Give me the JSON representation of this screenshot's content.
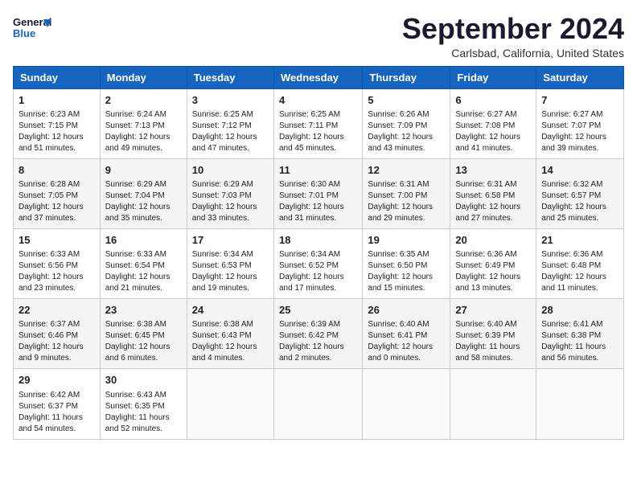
{
  "header": {
    "logo_line1": "General",
    "logo_line2": "Blue",
    "month_title": "September 2024",
    "location": "Carlsbad, California, United States"
  },
  "days_of_week": [
    "Sunday",
    "Monday",
    "Tuesday",
    "Wednesday",
    "Thursday",
    "Friday",
    "Saturday"
  ],
  "weeks": [
    [
      {
        "day": 1,
        "lines": [
          "Sunrise: 6:23 AM",
          "Sunset: 7:15 PM",
          "Daylight: 12 hours",
          "and 51 minutes."
        ]
      },
      {
        "day": 2,
        "lines": [
          "Sunrise: 6:24 AM",
          "Sunset: 7:13 PM",
          "Daylight: 12 hours",
          "and 49 minutes."
        ]
      },
      {
        "day": 3,
        "lines": [
          "Sunrise: 6:25 AM",
          "Sunset: 7:12 PM",
          "Daylight: 12 hours",
          "and 47 minutes."
        ]
      },
      {
        "day": 4,
        "lines": [
          "Sunrise: 6:25 AM",
          "Sunset: 7:11 PM",
          "Daylight: 12 hours",
          "and 45 minutes."
        ]
      },
      {
        "day": 5,
        "lines": [
          "Sunrise: 6:26 AM",
          "Sunset: 7:09 PM",
          "Daylight: 12 hours",
          "and 43 minutes."
        ]
      },
      {
        "day": 6,
        "lines": [
          "Sunrise: 6:27 AM",
          "Sunset: 7:08 PM",
          "Daylight: 12 hours",
          "and 41 minutes."
        ]
      },
      {
        "day": 7,
        "lines": [
          "Sunrise: 6:27 AM",
          "Sunset: 7:07 PM",
          "Daylight: 12 hours",
          "and 39 minutes."
        ]
      }
    ],
    [
      {
        "day": 8,
        "lines": [
          "Sunrise: 6:28 AM",
          "Sunset: 7:05 PM",
          "Daylight: 12 hours",
          "and 37 minutes."
        ]
      },
      {
        "day": 9,
        "lines": [
          "Sunrise: 6:29 AM",
          "Sunset: 7:04 PM",
          "Daylight: 12 hours",
          "and 35 minutes."
        ]
      },
      {
        "day": 10,
        "lines": [
          "Sunrise: 6:29 AM",
          "Sunset: 7:03 PM",
          "Daylight: 12 hours",
          "and 33 minutes."
        ]
      },
      {
        "day": 11,
        "lines": [
          "Sunrise: 6:30 AM",
          "Sunset: 7:01 PM",
          "Daylight: 12 hours",
          "and 31 minutes."
        ]
      },
      {
        "day": 12,
        "lines": [
          "Sunrise: 6:31 AM",
          "Sunset: 7:00 PM",
          "Daylight: 12 hours",
          "and 29 minutes."
        ]
      },
      {
        "day": 13,
        "lines": [
          "Sunrise: 6:31 AM",
          "Sunset: 6:58 PM",
          "Daylight: 12 hours",
          "and 27 minutes."
        ]
      },
      {
        "day": 14,
        "lines": [
          "Sunrise: 6:32 AM",
          "Sunset: 6:57 PM",
          "Daylight: 12 hours",
          "and 25 minutes."
        ]
      }
    ],
    [
      {
        "day": 15,
        "lines": [
          "Sunrise: 6:33 AM",
          "Sunset: 6:56 PM",
          "Daylight: 12 hours",
          "and 23 minutes."
        ]
      },
      {
        "day": 16,
        "lines": [
          "Sunrise: 6:33 AM",
          "Sunset: 6:54 PM",
          "Daylight: 12 hours",
          "and 21 minutes."
        ]
      },
      {
        "day": 17,
        "lines": [
          "Sunrise: 6:34 AM",
          "Sunset: 6:53 PM",
          "Daylight: 12 hours",
          "and 19 minutes."
        ]
      },
      {
        "day": 18,
        "lines": [
          "Sunrise: 6:34 AM",
          "Sunset: 6:52 PM",
          "Daylight: 12 hours",
          "and 17 minutes."
        ]
      },
      {
        "day": 19,
        "lines": [
          "Sunrise: 6:35 AM",
          "Sunset: 6:50 PM",
          "Daylight: 12 hours",
          "and 15 minutes."
        ]
      },
      {
        "day": 20,
        "lines": [
          "Sunrise: 6:36 AM",
          "Sunset: 6:49 PM",
          "Daylight: 12 hours",
          "and 13 minutes."
        ]
      },
      {
        "day": 21,
        "lines": [
          "Sunrise: 6:36 AM",
          "Sunset: 6:48 PM",
          "Daylight: 12 hours",
          "and 11 minutes."
        ]
      }
    ],
    [
      {
        "day": 22,
        "lines": [
          "Sunrise: 6:37 AM",
          "Sunset: 6:46 PM",
          "Daylight: 12 hours",
          "and 9 minutes."
        ]
      },
      {
        "day": 23,
        "lines": [
          "Sunrise: 6:38 AM",
          "Sunset: 6:45 PM",
          "Daylight: 12 hours",
          "and 6 minutes."
        ]
      },
      {
        "day": 24,
        "lines": [
          "Sunrise: 6:38 AM",
          "Sunset: 6:43 PM",
          "Daylight: 12 hours",
          "and 4 minutes."
        ]
      },
      {
        "day": 25,
        "lines": [
          "Sunrise: 6:39 AM",
          "Sunset: 6:42 PM",
          "Daylight: 12 hours",
          "and 2 minutes."
        ]
      },
      {
        "day": 26,
        "lines": [
          "Sunrise: 6:40 AM",
          "Sunset: 6:41 PM",
          "Daylight: 12 hours",
          "and 0 minutes."
        ]
      },
      {
        "day": 27,
        "lines": [
          "Sunrise: 6:40 AM",
          "Sunset: 6:39 PM",
          "Daylight: 11 hours",
          "and 58 minutes."
        ]
      },
      {
        "day": 28,
        "lines": [
          "Sunrise: 6:41 AM",
          "Sunset: 6:38 PM",
          "Daylight: 11 hours",
          "and 56 minutes."
        ]
      }
    ],
    [
      {
        "day": 29,
        "lines": [
          "Sunrise: 6:42 AM",
          "Sunset: 6:37 PM",
          "Daylight: 11 hours",
          "and 54 minutes."
        ]
      },
      {
        "day": 30,
        "lines": [
          "Sunrise: 6:43 AM",
          "Sunset: 6:35 PM",
          "Daylight: 11 hours",
          "and 52 minutes."
        ]
      },
      null,
      null,
      null,
      null,
      null
    ]
  ]
}
